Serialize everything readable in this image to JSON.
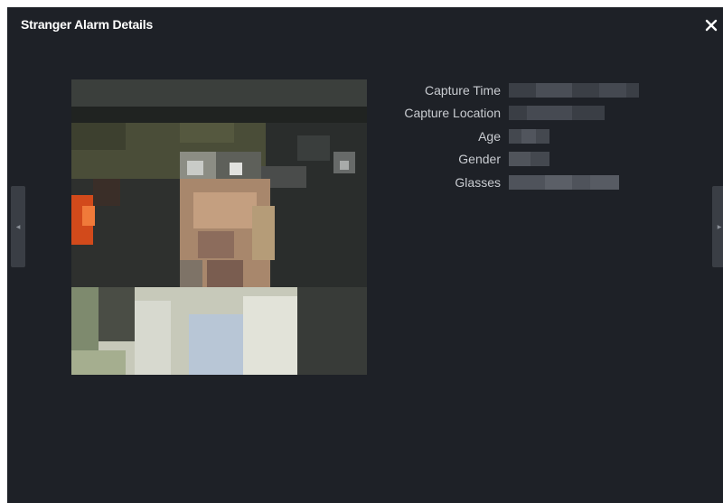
{
  "dialog": {
    "title": "Stranger Alarm Details",
    "close_icon": "close-icon",
    "background": "#1e2127"
  },
  "details": [
    {
      "label": "Capture Time"
    },
    {
      "label": "Capture Location"
    },
    {
      "label": "Age"
    },
    {
      "label": "Gender"
    },
    {
      "label": "Glasses"
    }
  ],
  "navigation": {
    "prev_icon": "chevron-left-icon",
    "next_icon": "chevron-right-icon",
    "prev_glyph": "◀",
    "next_glyph": "▶"
  }
}
